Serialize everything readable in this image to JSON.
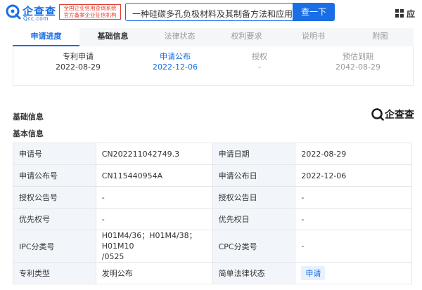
{
  "header": {
    "logo_text": "企查查",
    "logo_sub": "Qcc.com",
    "badge_line1": "全国企业信用查询系统",
    "badge_line2": "官方备案企业征信机构",
    "search_value": "一种硅碳多孔负极材料及其制备方法和应用",
    "search_button": "查一下",
    "app_label": "应"
  },
  "tabs": [
    {
      "label": "申请进度"
    },
    {
      "label": "基础信息"
    },
    {
      "label": "法律状态"
    },
    {
      "label": "权利要求"
    },
    {
      "label": "说明书"
    },
    {
      "label": "附图"
    }
  ],
  "timeline": [
    {
      "label": "专利申请",
      "date": "2022-08-29"
    },
    {
      "label": "申请公布",
      "date": "2022-12-06"
    },
    {
      "label": "授权",
      "date": "-"
    },
    {
      "label": "预估到期",
      "date": "2042-08-29"
    }
  ],
  "section_title": "基础信息",
  "sub_title": "基本信息",
  "brand_logo_text": "企查查",
  "rows": [
    {
      "k1": "申请号",
      "v1": "CN202211042749.3",
      "k2": "申请日期",
      "v2": "2022-08-29"
    },
    {
      "k1": "申请公布号",
      "v1": "CN115440954A",
      "k2": "申请公布日",
      "v2": "2022-12-06"
    },
    {
      "k1": "授权公告号",
      "v1": "-",
      "k2": "授权公告日",
      "v2": "-"
    },
    {
      "k1": "优先权号",
      "v1": "-",
      "k2": "优先权日",
      "v2": "-"
    },
    {
      "k1": "IPC分类号",
      "v1_line1": "H01M4/36；H01M4/38；H01M10",
      "v1_line2": "/0525",
      "k2": "CPC分类号",
      "v2": "-"
    },
    {
      "k1": "专利类型",
      "v1": "发明公布",
      "k2": "简单法律状态",
      "v2": "申请"
    }
  ],
  "colors": {
    "accent": "#1a6ee6",
    "badge_red": "#e23b2e",
    "key_bg": "#f2f6fb"
  },
  "icons": {
    "logo": "qcc-logo-icon",
    "app": "app-grid-icon"
  }
}
